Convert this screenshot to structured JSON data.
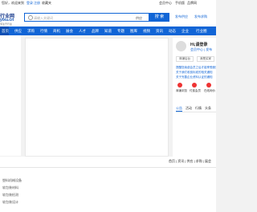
{
  "topbar": {
    "left_text": "您好，欢迎来到",
    "login": "登录",
    "register": "注册",
    "favorite": "收藏夹",
    "right1": "会员中心",
    "right2": "手机版",
    "right3": "品牌网"
  },
  "logo": {
    "line1": "行业网",
    "line2": "yixu.cn",
    "line3": "专注于行业"
  },
  "search": {
    "placeholder": "请输入关键词",
    "select": "供应",
    "button": "搜 索"
  },
  "publish": {
    "item1": "发布供应",
    "item2": "发布求购"
  },
  "nav": {
    "items": [
      "首页",
      "供应",
      "求购",
      "行情",
      "商机",
      "展会",
      "人才",
      "品牌",
      "知道",
      "专题",
      "图库",
      "视频",
      "资讯",
      "动态",
      "企业",
      "行业圈"
    ]
  },
  "card": {
    "name": "Hi,请登录",
    "links": "会员中心 | 发布",
    "btn1": "商铺后台",
    "btn2": "我是买家",
    "msgs": [
      "提醒您续费会员之后才能享受服务",
      "关于我们收费标准的相关通知",
      "关于完善企业资料认证的通知"
    ],
    "stats": [
      "商铺浏览",
      "付费会员",
      "在线询价"
    ],
    "tabs": [
      "公告",
      "活动",
      "行情",
      "头条"
    ]
  },
  "footer": {
    "links": "首页 | 资讯 | 供应 | 求购 | 展会",
    "left": [
      "塑料机械设备",
      "软包装材料",
      "软包装检测",
      "软包装设计"
    ]
  }
}
